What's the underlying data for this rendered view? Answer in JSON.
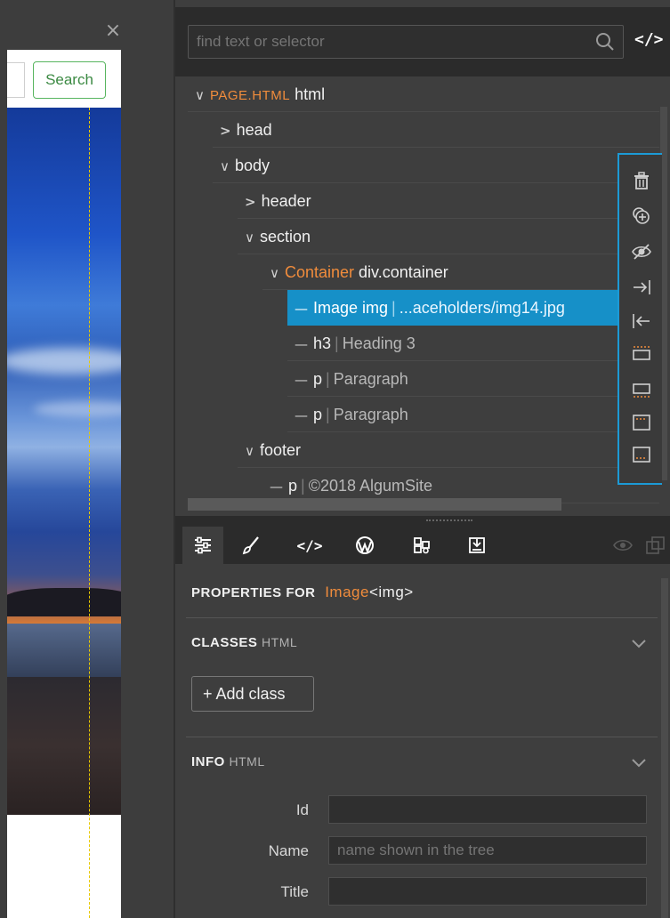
{
  "canvas": {
    "close_glyph": "×",
    "search_button_label": "Search"
  },
  "tree_panel": {
    "filter_placeholder": "find text or selector",
    "code_toggle_glyph": "</>",
    "rows": [
      {
        "arrow": "∨",
        "prefix": "PAGE.HTML",
        "name": "html",
        "suffix": ""
      },
      {
        "arrow": ">",
        "prefix": "",
        "name": "head",
        "suffix": ""
      },
      {
        "arrow": "∨",
        "prefix": "",
        "name": "body",
        "suffix": ""
      },
      {
        "arrow": ">",
        "prefix": "",
        "name": "header",
        "suffix": ""
      },
      {
        "arrow": "∨",
        "prefix": "",
        "name": "section",
        "suffix": ""
      },
      {
        "arrow": "∨",
        "prefix": "Container",
        "name": "div.container",
        "suffix": ""
      },
      {
        "arrow": "—",
        "prefix": "",
        "name": "Image img",
        "suffix": "...aceholders/img14.jpg"
      },
      {
        "arrow": "—",
        "prefix": "",
        "name": "h3",
        "suffix": "Heading 3"
      },
      {
        "arrow": "—",
        "prefix": "",
        "name": "p",
        "suffix": "Paragraph"
      },
      {
        "arrow": "—",
        "prefix": "",
        "name": "p",
        "suffix": "Paragraph"
      },
      {
        "arrow": "∨",
        "prefix": "",
        "name": "footer",
        "suffix": ""
      },
      {
        "arrow": "—",
        "prefix": "",
        "name": "p",
        "suffix": "©2018 AlgumSite"
      }
    ],
    "side_tools": [
      "trash-icon",
      "duplicate-icon",
      "hide-icon",
      "indent-icon",
      "outdent-icon",
      "insert-before-icon",
      "insert-after-icon",
      "insert-first-icon",
      "insert-last-icon"
    ]
  },
  "bottom_tabs": [
    "properties-icon",
    "style-brush-icon",
    "code-icon",
    "wordpress-icon",
    "components-icon",
    "export-icon"
  ],
  "properties": {
    "title_prefix": "PROPERTIES FOR",
    "element_name": "Image",
    "element_tag": "<img>",
    "classes_section": {
      "title": "CLASSES",
      "subtitle": "HTML"
    },
    "add_class_label": "+ Add class",
    "info_section": {
      "title": "INFO",
      "subtitle": "HTML"
    },
    "fields": [
      {
        "label": "Id",
        "value": "",
        "placeholder": ""
      },
      {
        "label": "Name",
        "value": "",
        "placeholder": "name shown in the tree"
      },
      {
        "label": "Title",
        "value": "",
        "placeholder": ""
      }
    ]
  },
  "colors": {
    "accent_blue": "#1690c8",
    "accent_orange": "#f08c3c",
    "panel_bg": "#3e3e3e",
    "toolbar_border": "#1c9ad6",
    "guide_yellow": "#e8c800",
    "search_green": "#58b55f"
  }
}
